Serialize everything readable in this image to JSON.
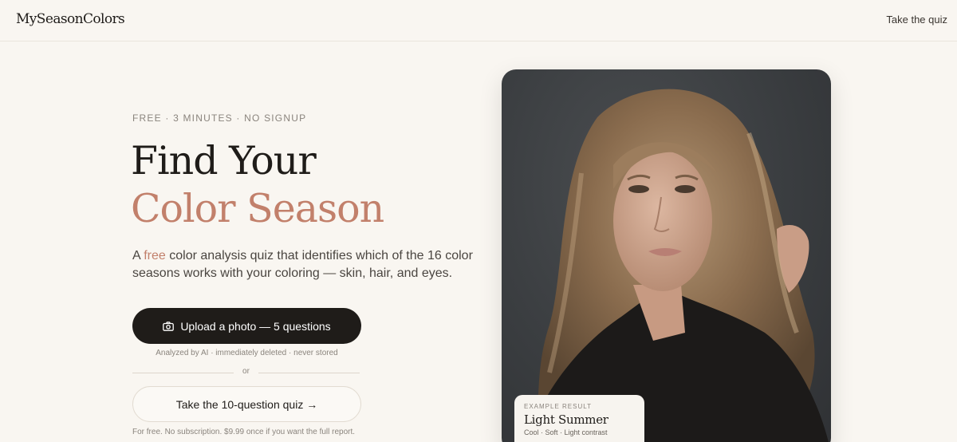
{
  "header": {
    "logo": "MySeasonColors",
    "nav_link": "Take the quiz"
  },
  "hero": {
    "eyebrow": "FREE · 3 MINUTES · NO SIGNUP",
    "title_line1": "Find Your",
    "title_line2": "Color Season",
    "lead_before": "A ",
    "lead_accent": "free",
    "lead_after": " color analysis quiz that identifies which of the 16 color seasons works with your coloring — skin, hair, and eyes.",
    "primary_button": "Upload a photo — 5 questions",
    "primary_note": "Analyzed by AI · immediately deleted · never stored",
    "divider_text": "or",
    "secondary_button": "Take the 10-question quiz →",
    "secondary_note": "For free. No subscription. $9.99 once if you want the full report."
  },
  "example": {
    "eyebrow": "EXAMPLE RESULT",
    "title": "Light Summer",
    "description": "Cool · Soft · Light contrast"
  },
  "icons": {
    "primary_button_icon": "camera-icon"
  },
  "colors": {
    "background": "#f9f6f1",
    "accent": "#c2806b",
    "primary_button": "#1f1c19"
  }
}
